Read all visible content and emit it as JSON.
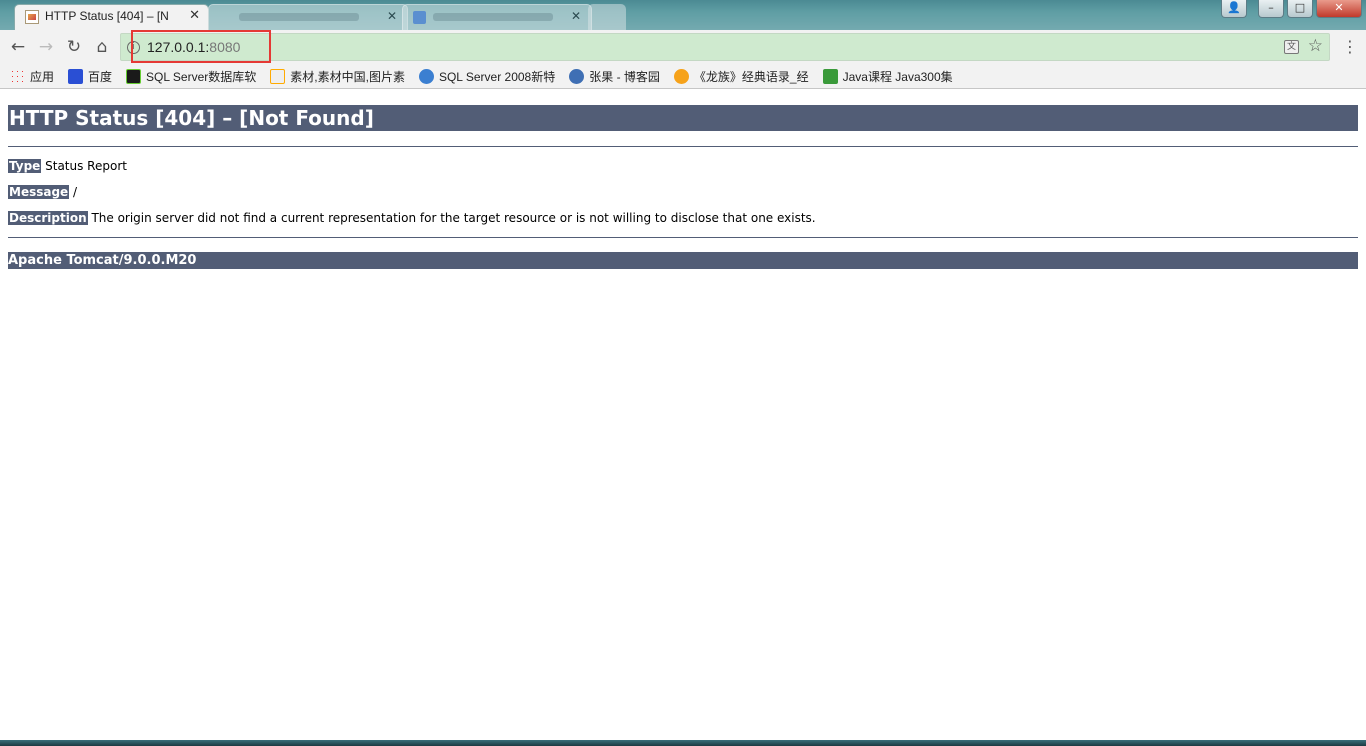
{
  "browser": {
    "active_tab": {
      "title": "HTTP Status [404] – [N",
      "close": "✕"
    },
    "window_buttons": {
      "minimize": "–",
      "maximize": "□",
      "close": "✕",
      "user": "👤"
    },
    "url": {
      "host": "127.0.0.1:",
      "port": "8080"
    },
    "menu": "⋮",
    "star": "☆",
    "translate": "文"
  },
  "bookmarks": [
    {
      "label": "应用",
      "icon": "apps-icon"
    },
    {
      "label": "百度",
      "icon": "baidu-icon"
    },
    {
      "label": "SQL Server数据库软",
      "icon": "sql-icon"
    },
    {
      "label": "素材,素材中国,图片素",
      "icon": "sucai-icon"
    },
    {
      "label": "SQL Server 2008新特",
      "icon": "sql2-icon"
    },
    {
      "label": "张果 - 博客园",
      "icon": "blog-icon"
    },
    {
      "label": "《龙族》经典语录_经",
      "icon": "longzu-icon"
    },
    {
      "label": "Java课程 Java300集",
      "icon": "java-icon"
    }
  ],
  "page": {
    "heading": "HTTP Status [404] – [Not Found]",
    "type_label": "Type",
    "type_value": " Status Report",
    "message_label": "Message",
    "message_value": " /",
    "description_label": "Description",
    "description_value": " The origin server did not find a current representation for the target resource or is not willing to disclose that one exists.",
    "server": "Apache Tomcat/9.0.0.M20"
  },
  "colors": {
    "tomcat_header": "#525d76",
    "omnibox_bg": "#cfeacf",
    "highlight_box": "#e53935"
  }
}
